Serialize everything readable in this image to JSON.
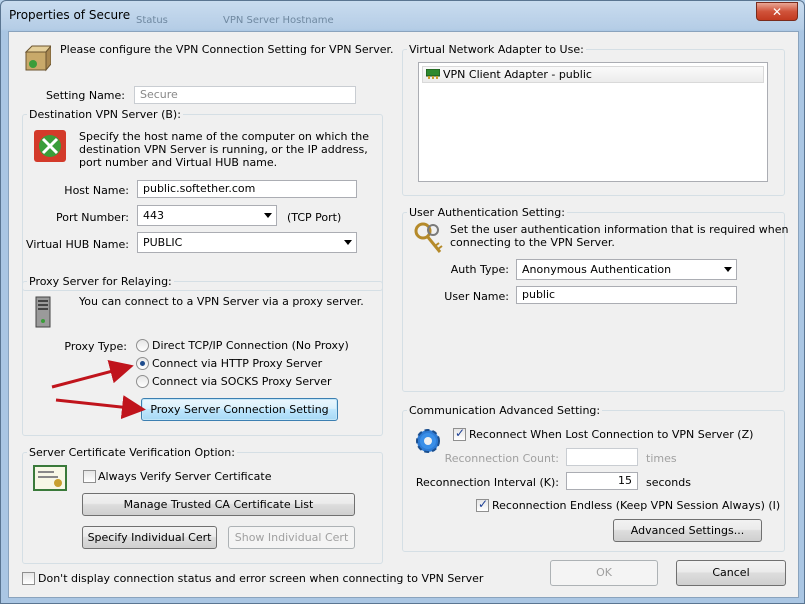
{
  "window": {
    "title": "Properties of Secure",
    "close_label": "✕"
  },
  "background_tabs": [
    "Status",
    "VPN Server Hostname"
  ],
  "intro_text": "Please configure the VPN Connection Setting for VPN Server.",
  "setting_name": {
    "label": "Setting Name:",
    "value": "Secure"
  },
  "destination": {
    "group_label": "Destination VPN Server (B):",
    "description": [
      "Specify the host name of the computer on which the",
      "destination VPN Server is running, or the IP address,",
      "port number and Virtual HUB name."
    ],
    "host_label": "Host Name:",
    "host_value": "public.softether.com",
    "port_label": "Port Number:",
    "port_value": "443",
    "port_unit": "(TCP Port)",
    "hub_label": "Virtual HUB Name:",
    "hub_value": "PUBLIC"
  },
  "proxy": {
    "group_label": "Proxy Server for Relaying:",
    "description": "You can connect to a VPN Server via a proxy server.",
    "type_label": "Proxy Type:",
    "options": [
      "Direct TCP/IP Connection (No Proxy)",
      "Connect via HTTP Proxy Server",
      "Connect via SOCKS Proxy Server"
    ],
    "selected_index": 1,
    "setting_button": "Proxy Server Connection Setting"
  },
  "certificate": {
    "group_label": "Server Certificate Verification Option:",
    "always_verify_label": "Always Verify Server Certificate",
    "always_verify_checked": false,
    "manage_ca_button": "Manage Trusted CA Certificate List",
    "specify_cert_button": "Specify Individual Cert",
    "show_cert_button": "Show Individual Cert"
  },
  "adapter": {
    "group_label": "Virtual Network Adapter to Use:",
    "items": [
      "VPN Client Adapter - public"
    ]
  },
  "auth": {
    "group_label": "User Authentication Setting:",
    "description": [
      "Set the user authentication information that is required when",
      "connecting to the VPN Server."
    ],
    "type_label": "Auth Type:",
    "type_value": "Anonymous Authentication",
    "user_label": "User Name:",
    "user_value": "public"
  },
  "advanced": {
    "group_label": "Communication Advanced Setting:",
    "reconnect_label": "Reconnect When Lost Connection to VPN Server (Z)",
    "reconnect_checked": true,
    "count_label": "Reconnection Count:",
    "count_value": "",
    "count_unit": "times",
    "interval_label": "Reconnection Interval (K):",
    "interval_value": "15",
    "interval_unit": "seconds",
    "endless_label": "Reconnection Endless (Keep VPN Session Always) (I)",
    "endless_checked": true,
    "settings_button": "Advanced Settings..."
  },
  "footer": {
    "dont_display_label": "Don't display connection status and error screen when connecting to VPN Server",
    "dont_display_checked": false,
    "ok_button": "OK",
    "cancel_button": "Cancel"
  },
  "colors": {
    "annotation_arrow": "#c0141c",
    "accent": "#3c7fb1"
  }
}
